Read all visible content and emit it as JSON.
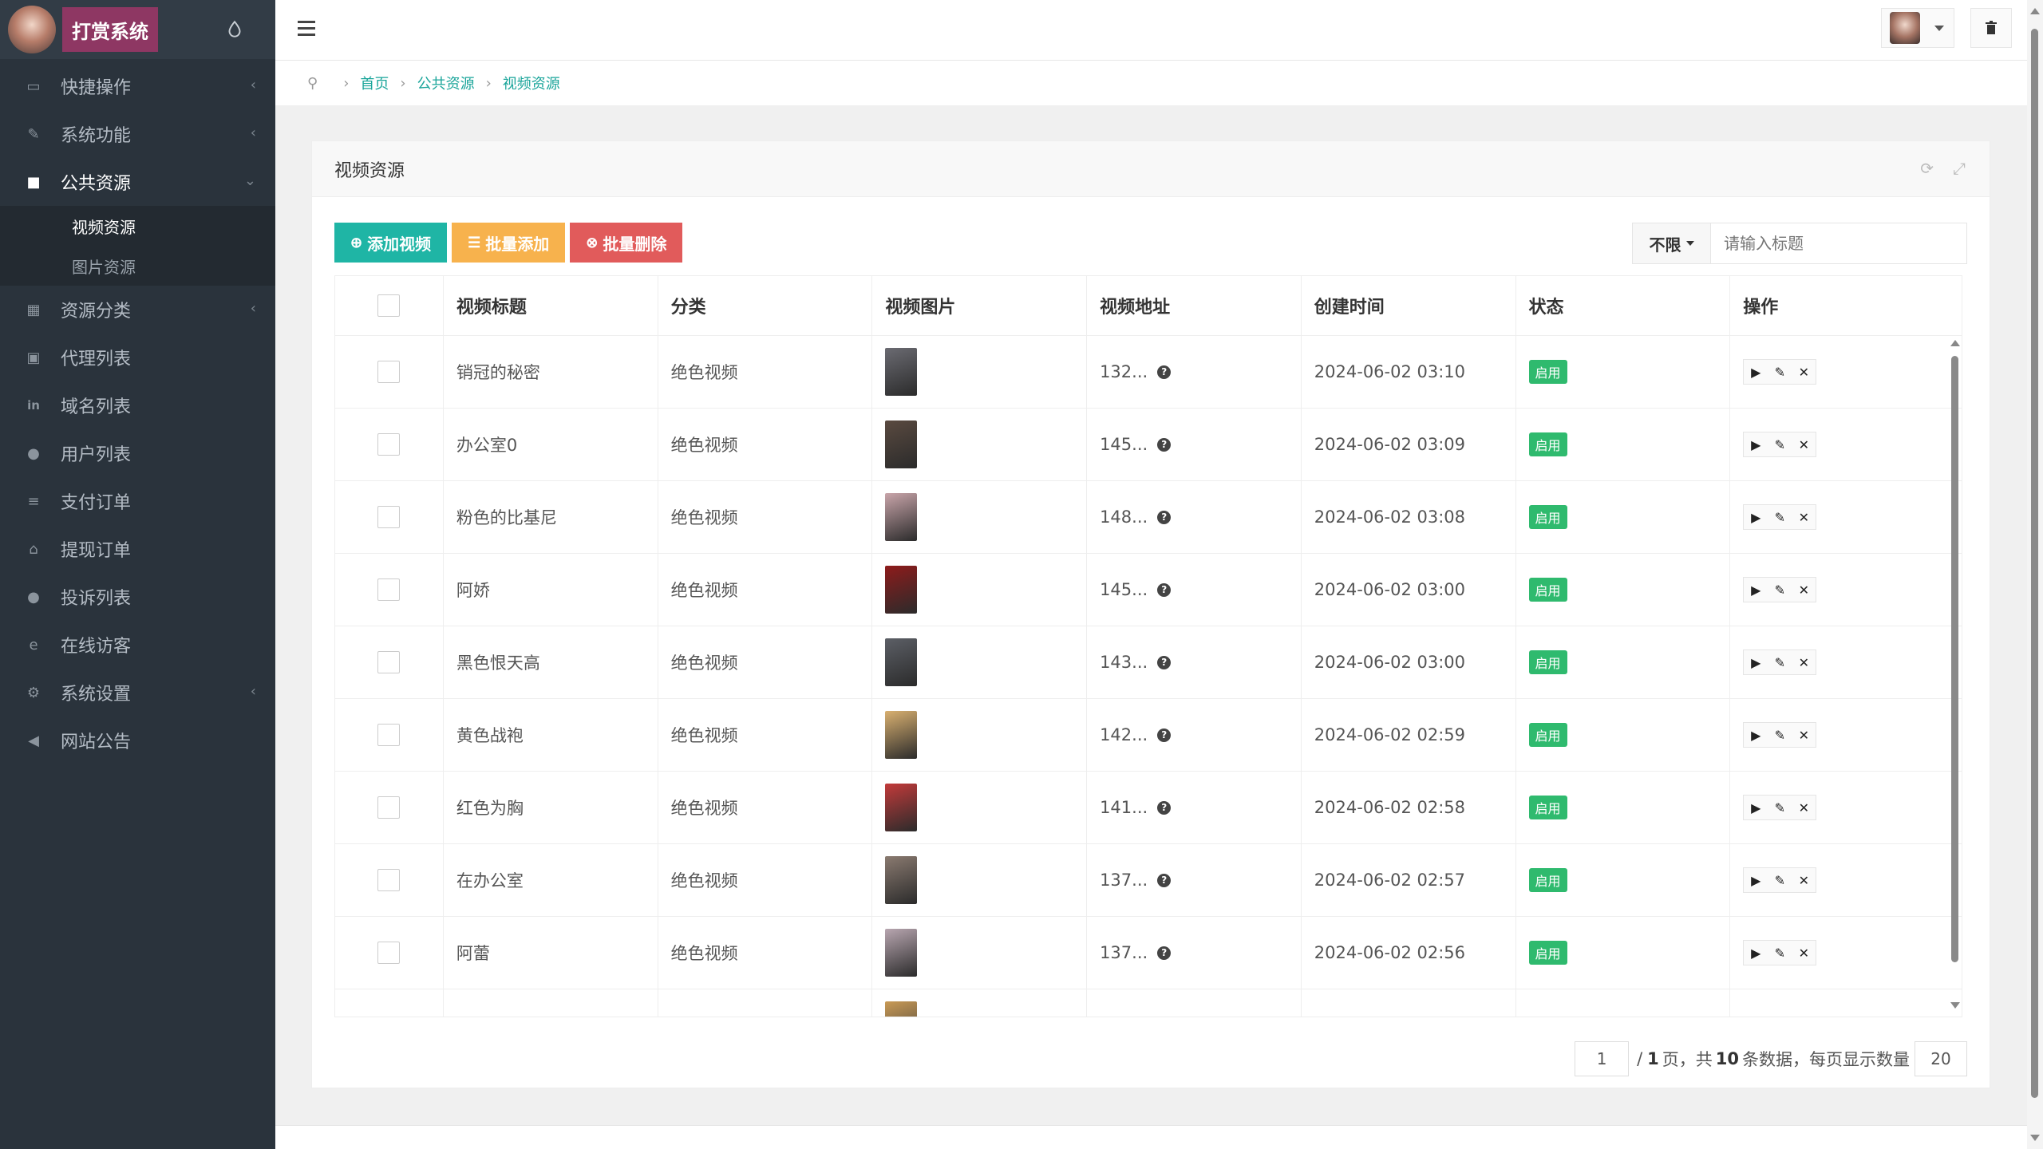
{
  "app": {
    "title": "打赏系统"
  },
  "sidebar": {
    "items": [
      {
        "label": "快捷操作",
        "icon": "folder-open-icon",
        "chevron": "‹"
      },
      {
        "label": "系统功能",
        "icon": "wrench-icon",
        "chevron": "‹"
      },
      {
        "label": "公共资源",
        "icon": "video-camera-icon",
        "chevron": "⌄"
      },
      {
        "label": "资源分类",
        "icon": "grid-icon",
        "chevron": "‹"
      },
      {
        "label": "代理列表",
        "icon": "gift-icon",
        "chevron": ""
      },
      {
        "label": "域名列表",
        "icon": "linkedin-icon",
        "chevron": ""
      },
      {
        "label": "用户列表",
        "icon": "user-icon",
        "chevron": ""
      },
      {
        "label": "支付订单",
        "icon": "database-icon",
        "chevron": ""
      },
      {
        "label": "提现订单",
        "icon": "bank-icon",
        "chevron": ""
      },
      {
        "label": "投诉列表",
        "icon": "alert-circle-icon",
        "chevron": ""
      },
      {
        "label": "在线访客",
        "icon": "ie-icon",
        "chevron": ""
      },
      {
        "label": "系统设置",
        "icon": "gear-icon",
        "chevron": "‹"
      },
      {
        "label": "网站公告",
        "icon": "bullhorn-icon",
        "chevron": ""
      }
    ],
    "sub_items": [
      {
        "label": "视频资源"
      },
      {
        "label": "图片资源"
      }
    ]
  },
  "breadcrumb": {
    "home": "首页",
    "section": "公共资源",
    "current": "视频资源"
  },
  "panel": {
    "title": "视频资源"
  },
  "toolbar": {
    "add_label": "添加视频",
    "batch_add_label": "批量添加",
    "batch_delete_label": "批量删除"
  },
  "filter": {
    "select_value": "不限",
    "search_placeholder": "请输入标题"
  },
  "table": {
    "headers": [
      "视频标题",
      "分类",
      "视频图片",
      "视频地址",
      "创建时间",
      "状态",
      "操作"
    ],
    "rows": [
      {
        "title": "销冠的秘密",
        "category": "绝色视频",
        "url": "132...",
        "created": "2024-06-02 03:10",
        "status": "启用",
        "thumb": "#6b6b72"
      },
      {
        "title": "办公室0",
        "category": "绝色视频",
        "url": "145...",
        "created": "2024-06-02 03:09",
        "status": "启用",
        "thumb": "#5a4a40"
      },
      {
        "title": "粉色的比基尼",
        "category": "绝色视频",
        "url": "148...",
        "created": "2024-06-02 03:08",
        "status": "启用",
        "thumb": "#c9a5aa"
      },
      {
        "title": "阿娇",
        "category": "绝色视频",
        "url": "145...",
        "created": "2024-06-02 03:00",
        "status": "启用",
        "thumb": "#8e1b1b"
      },
      {
        "title": "黑色恨天高",
        "category": "绝色视频",
        "url": "143...",
        "created": "2024-06-02 03:00",
        "status": "启用",
        "thumb": "#5c5f66"
      },
      {
        "title": "黄色战袍",
        "category": "绝色视频",
        "url": "142...",
        "created": "2024-06-02 02:59",
        "status": "启用",
        "thumb": "#d9b070"
      },
      {
        "title": "红色为胸",
        "category": "绝色视频",
        "url": "141...",
        "created": "2024-06-02 02:58",
        "status": "启用",
        "thumb": "#c23a3a"
      },
      {
        "title": "在办公室",
        "category": "绝色视频",
        "url": "137...",
        "created": "2024-06-02 02:57",
        "status": "启用",
        "thumb": "#8a7a70"
      },
      {
        "title": "阿蕾",
        "category": "绝色视频",
        "url": "137...",
        "created": "2024-06-02 02:56",
        "status": "启用",
        "thumb": "#b8a6b0"
      }
    ]
  },
  "pagination": {
    "page": "1",
    "sep": "/",
    "total_pages": "1",
    "page_unit": "页，共",
    "total_records": "10",
    "records_unit": "条数据，每页显示数量",
    "page_size": "20"
  },
  "colors": {
    "accent": "#1fb5a5",
    "orange": "#f7b24d",
    "red": "#e15b5b",
    "status_green": "#2fba6e",
    "sidebar_bg": "#2a333c"
  }
}
